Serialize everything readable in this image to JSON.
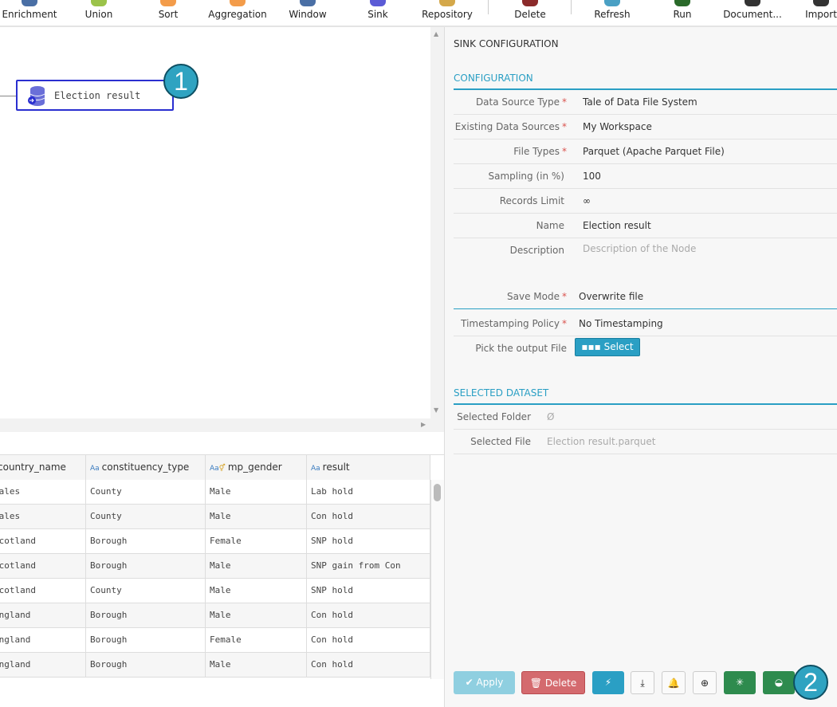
{
  "toolbar": {
    "items": [
      {
        "label": "Enrichment",
        "icon": "enrichment-icon",
        "color": "#4a6fa5"
      },
      {
        "label": "Union",
        "icon": "union-icon",
        "color": "#9bc34a"
      },
      {
        "label": "Sort",
        "icon": "sort-icon",
        "color": "#f39c4a"
      },
      {
        "label": "Aggregation",
        "icon": "aggregation-icon",
        "color": "#f39c4a"
      },
      {
        "label": "Window",
        "icon": "window-icon",
        "color": "#4a6fa5"
      },
      {
        "label": "Sink",
        "icon": "sink-icon",
        "color": "#5b5bd6"
      },
      {
        "label": "Repository",
        "icon": "repository-icon",
        "color": "#d4a84a"
      },
      {
        "label": "Delete",
        "icon": "delete-icon",
        "color": "#8b2a2a"
      },
      {
        "label": "Refresh",
        "icon": "refresh-icon",
        "color": "#4aa0c4"
      },
      {
        "label": "Run",
        "icon": "run-icon",
        "color": "#2a6a2a"
      },
      {
        "label": "Document...",
        "icon": "document-icon",
        "color": "#333333"
      },
      {
        "label": "Import",
        "icon": "import-icon",
        "color": "#333333"
      }
    ]
  },
  "canvas": {
    "node_label": "Election result",
    "badge1": "1"
  },
  "table": {
    "columns": [
      "country_name",
      "constituency_type",
      "mp_gender",
      "result"
    ],
    "rows": [
      [
        "Wales",
        "County",
        "Male",
        "Lab hold"
      ],
      [
        "Wales",
        "County",
        "Male",
        "Con hold"
      ],
      [
        "Scotland",
        "Borough",
        "Female",
        "SNP hold"
      ],
      [
        "Scotland",
        "Borough",
        "Male",
        "SNP gain from Con"
      ],
      [
        "Scotland",
        "County",
        "Male",
        "SNP hold"
      ],
      [
        "England",
        "Borough",
        "Male",
        "Con hold"
      ],
      [
        "England",
        "Borough",
        "Female",
        "Con hold"
      ],
      [
        "England",
        "Borough",
        "Male",
        "Con hold"
      ]
    ]
  },
  "panel": {
    "title": "SINK CONFIGURATION",
    "config_header": "CONFIGURATION",
    "fields": [
      {
        "label": "Data Source Type",
        "value": "Tale of Data File System",
        "required": "*"
      },
      {
        "label": "Existing Data Sources",
        "value": "My Workspace",
        "required": "*"
      },
      {
        "label": "File Types",
        "value": "Parquet (Apache Parquet File)",
        "required": "*"
      },
      {
        "label": "Sampling (in %)",
        "value": "100",
        "required": ""
      },
      {
        "label": "Records Limit",
        "value": "∞",
        "required": ""
      },
      {
        "label": "Name",
        "value": "Election result",
        "required": ""
      },
      {
        "label": "Description",
        "placeholder": "Description of the Node",
        "required": ""
      }
    ],
    "save_mode": {
      "label": "Save Mode",
      "value": "Overwrite file",
      "required": "*"
    },
    "timestamping": {
      "label": "Timestamping Policy",
      "value": "No Timestamping",
      "required": "*"
    },
    "output_file": {
      "label": "Pick the output File",
      "button": "Select"
    },
    "dataset_header": "SELECTED DATASET",
    "selected_folder": {
      "label": "Selected Folder",
      "value": "Ø"
    },
    "selected_file": {
      "label": "Selected File",
      "value": "Election result.parquet"
    },
    "buttons": {
      "apply": "Apply",
      "delete": "Delete"
    },
    "badge2": "2"
  },
  "colors": {
    "accent": "#2a9fc4",
    "danger": "#d9534f",
    "success": "#2e8b4e",
    "node_border": "#2a2fd0"
  }
}
